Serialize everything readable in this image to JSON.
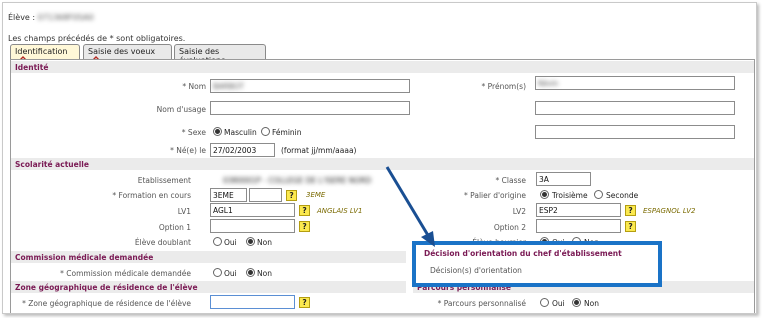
{
  "student": {
    "label": "Élève :",
    "value": "071368F0SA0"
  },
  "required_note": "Les champs précédés de * sont obligatoires.",
  "tabs": [
    "Identification",
    "Saisie des voeux",
    "Saisie des évaluations"
  ],
  "sections": {
    "identite": "Identité",
    "scolarite": "Scolarité actuelle",
    "commission": "Commission médicale demandée",
    "zone": "Zone géographique de résidence de l'élève",
    "decision": "Décision d'orientation du chef d'établissement",
    "parcours": "Parcours personnalisé"
  },
  "identite": {
    "nom_label": "* Nom",
    "nom_value": "BARBOT",
    "prenom_label": "* Prénom(s)",
    "prenom_value": "Kévin",
    "nom_usage_label": "Nom d'usage",
    "sexe_label": "* Sexe",
    "masculin": "Masculin",
    "feminin": "Féminin",
    "naissance_label": "* Né(e) le",
    "naissance_value": "27/02/2003",
    "naissance_format": "(format jj/mm/aaaa)"
  },
  "scolarite": {
    "etablissement_label": "Etablissement",
    "etablissement_value": "0380001P - COLLEGE DE L'ISERE NORD",
    "classe_label": "* Classe",
    "classe_value": "3A",
    "formation_label": "* Formation en cours",
    "formation_value": "3EME",
    "formation_note": "3EME",
    "palier_label": "* Palier d'origine",
    "troisieme": "Troisième",
    "seconde": "Seconde",
    "lv1_label": "LV1",
    "lv1_value": "AGL1",
    "lv1_note": "ANGLAIS LV1",
    "lv2_label": "LV2",
    "lv2_value": "ESP2",
    "lv2_note": "ESPAGNOL LV2",
    "option1_label": "Option 1",
    "option2_label": "Option 2",
    "doublant_label": "Élève doublant",
    "boursier_label": "Élève boursier",
    "oui": "Oui",
    "non": "Non"
  },
  "commission": {
    "label": "* Commission médicale demandée"
  },
  "zone": {
    "label": "* Zone géographique de résidence de l'élève"
  },
  "decision": {
    "label": "Décision(s) d'orientation"
  },
  "parcours": {
    "label": "* Parcours personnalisé"
  },
  "help_glyph": "?",
  "colors": {
    "section_text": "#7a1a54",
    "highlight": "#1a73c7",
    "help_button": "#fbe94f",
    "warning": "#b3261e"
  }
}
